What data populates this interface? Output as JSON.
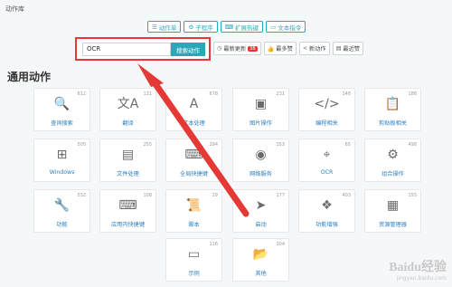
{
  "app": {
    "title": "动作库"
  },
  "tabs": [
    {
      "label": "动作单",
      "icon": "list-icon"
    },
    {
      "label": "子程序",
      "icon": "subroutine-icon"
    },
    {
      "label": "扩展热键",
      "icon": "keyboard-icon"
    },
    {
      "label": "文本指令",
      "icon": "text-command-icon"
    }
  ],
  "search": {
    "value": "OCR",
    "button_label": "搜索动作"
  },
  "sort": {
    "latest": {
      "label": "最新更新",
      "badge": "38"
    },
    "most_liked": {
      "label": "最多赞"
    },
    "new_action": {
      "label": "新动作"
    },
    "recent_liked": {
      "label": "最近赞"
    }
  },
  "section": {
    "title": "通用动作"
  },
  "categories": [
    {
      "label": "查询搜索",
      "count": "612",
      "icon": "search-icon",
      "glyph": "🔍"
    },
    {
      "label": "翻译",
      "count": "131",
      "icon": "translate-icon",
      "glyph": "文A"
    },
    {
      "label": "文本处理",
      "count": "678",
      "icon": "text-processing-icon",
      "glyph": "A"
    },
    {
      "label": "图片操作",
      "count": "231",
      "icon": "image-icon",
      "glyph": "▣"
    },
    {
      "label": "编程相关",
      "count": "148",
      "icon": "code-icon",
      "glyph": "</>"
    },
    {
      "label": "剪贴板相关",
      "count": "186",
      "icon": "clipboard-icon",
      "glyph": "📋"
    },
    {
      "label": "Windows",
      "count": "505",
      "icon": "windows-icon",
      "glyph": "⊞"
    },
    {
      "label": "文件处理",
      "count": "255",
      "icon": "file-icon",
      "glyph": "▤"
    },
    {
      "label": "全局快捷键",
      "count": "294",
      "icon": "global-hotkey-icon",
      "glyph": "⌨"
    },
    {
      "label": "网络服务",
      "count": "353",
      "icon": "network-icon",
      "glyph": "◉"
    },
    {
      "label": "OCR",
      "count": "65",
      "icon": "ocr-icon",
      "glyph": "⌖"
    },
    {
      "label": "组合操作",
      "count": "498",
      "icon": "combination-icon",
      "glyph": "⚙"
    },
    {
      "label": "功能",
      "count": "532",
      "icon": "wrench-icon",
      "glyph": "🔧"
    },
    {
      "label": "应用内快捷键",
      "count": "108",
      "icon": "in-app-hotkey-icon",
      "glyph": "⌨"
    },
    {
      "label": "脚本",
      "count": "29",
      "icon": "script-icon",
      "glyph": "📜"
    },
    {
      "label": "启动",
      "count": "177",
      "icon": "launch-icon",
      "glyph": "➤"
    },
    {
      "label": "功能增强",
      "count": "403",
      "icon": "enhance-icon",
      "glyph": "❖"
    },
    {
      "label": "资源管理器",
      "count": "155",
      "icon": "explorer-icon",
      "glyph": "▦"
    },
    {
      "label": "示例",
      "count": "116",
      "icon": "example-icon",
      "glyph": "▭"
    },
    {
      "label": "其他",
      "count": "304",
      "icon": "folder-icon",
      "glyph": "📂"
    }
  ],
  "watermark": {
    "title": "Baidu经验",
    "subtitle": "jingyan.baidu.com"
  },
  "colors": {
    "accent": "#2aa7b8",
    "highlight": "#e53935",
    "link": "#2b7fc3"
  }
}
